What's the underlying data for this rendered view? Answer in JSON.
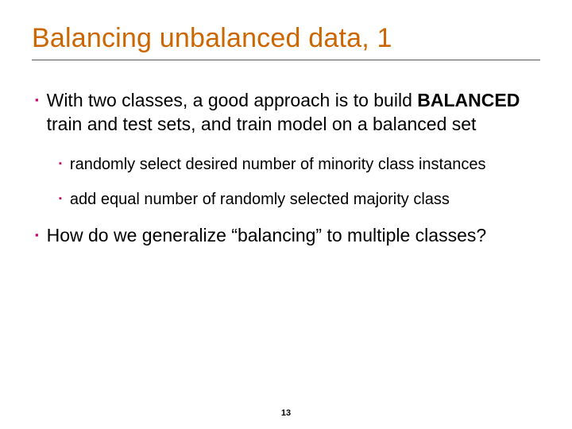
{
  "slide": {
    "title": "Balancing unbalanced data, 1",
    "bullets": [
      {
        "level": 1,
        "pre": "With two classes, a good approach is to build ",
        "strong": "BALANCED",
        "post": " train and test sets, and train model on a balanced set"
      },
      {
        "level": 2,
        "text": "randomly select desired number of minority class instances"
      },
      {
        "level": 2,
        "text": "add equal number of randomly selected majority class"
      },
      {
        "level": 1,
        "text": "How do we generalize “balancing” to multiple classes?"
      }
    ],
    "page_number": "13"
  },
  "glyphs": {
    "bullet": "▪"
  }
}
